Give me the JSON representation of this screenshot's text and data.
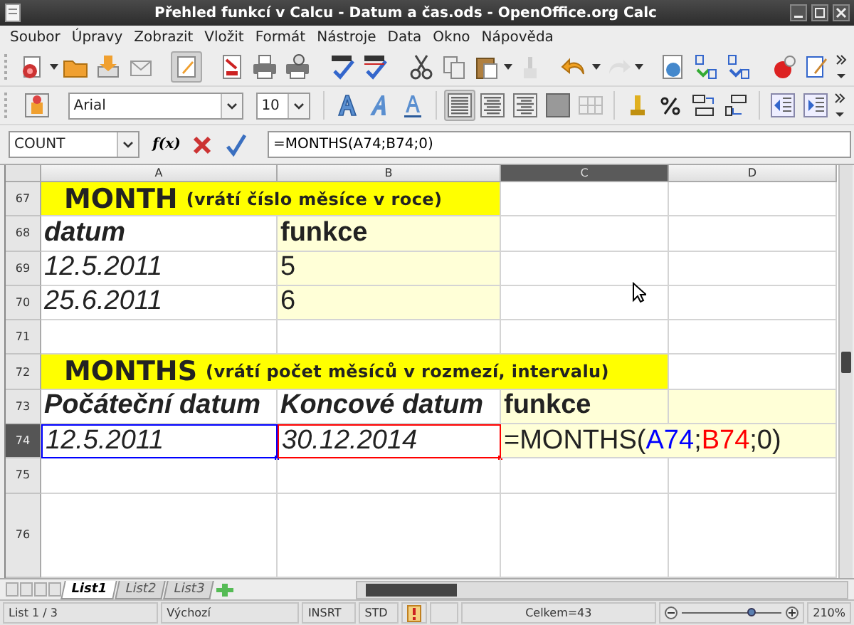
{
  "window": {
    "title": "Přehled funkcí v Calcu - Datum a čas.ods - OpenOffice.org Calc"
  },
  "menu": [
    "Soubor",
    "Úpravy",
    "Zobrazit",
    "Vložit",
    "Formát",
    "Nástroje",
    "Data",
    "Okno",
    "Nápověda"
  ],
  "formatting": {
    "font": "Arial",
    "size": "10"
  },
  "formula_bar": {
    "name_box": "COUNT",
    "function_label": "f(x)",
    "value": "=MONTHS(A74;B74;0)"
  },
  "columns": [
    {
      "label": "A",
      "selected": false
    },
    {
      "label": "B",
      "selected": false
    },
    {
      "label": "C",
      "selected": true
    },
    {
      "label": "D",
      "selected": false
    }
  ],
  "rows": [
    {
      "number": "67",
      "selected": false,
      "cells": [
        {
          "kind": "title",
          "title": "MONTH",
          "subtitle": "(vrátí číslo měsíce v roce)"
        },
        {
          "kind": "empty",
          "shaded": false
        },
        {
          "kind": "empty",
          "shaded": false
        }
      ]
    },
    {
      "number": "68",
      "selected": false,
      "cells": [
        {
          "kind": "heading",
          "text": "datum",
          "italic": true,
          "shaded": false
        },
        {
          "kind": "heading",
          "text": "funkce",
          "italic": false,
          "shaded": true
        },
        {
          "kind": "empty",
          "shaded": false
        },
        {
          "kind": "empty",
          "shaded": false
        }
      ]
    },
    {
      "number": "69",
      "selected": false,
      "cells": [
        {
          "kind": "value",
          "text": "12.5.2011",
          "italic": true,
          "shaded": false
        },
        {
          "kind": "value",
          "text": "5",
          "italic": false,
          "shaded": true
        },
        {
          "kind": "empty",
          "shaded": false
        },
        {
          "kind": "empty",
          "shaded": false
        }
      ]
    },
    {
      "number": "70",
      "selected": false,
      "cells": [
        {
          "kind": "value",
          "text": "25.6.2011",
          "italic": true,
          "shaded": false
        },
        {
          "kind": "value",
          "text": "6",
          "italic": false,
          "shaded": true
        },
        {
          "kind": "empty",
          "shaded": false
        },
        {
          "kind": "empty",
          "shaded": false
        }
      ]
    },
    {
      "number": "71",
      "selected": false,
      "cells": [
        {
          "kind": "empty",
          "shaded": false
        },
        {
          "kind": "empty",
          "shaded": false
        },
        {
          "kind": "empty",
          "shaded": false
        },
        {
          "kind": "empty",
          "shaded": false
        }
      ]
    },
    {
      "number": "72",
      "selected": false,
      "cells": [
        {
          "kind": "title",
          "title": "MONTHS",
          "subtitle": "(vrátí počet měsíců v rozmezí, intervalu)"
        },
        {
          "kind": "empty",
          "shaded": false
        }
      ]
    },
    {
      "number": "73",
      "selected": false,
      "cells": [
        {
          "kind": "heading",
          "text": "Počáteční datum",
          "italic": true,
          "shaded": false
        },
        {
          "kind": "heading",
          "text": "Koncové datum",
          "italic": true,
          "shaded": false
        },
        {
          "kind": "heading",
          "text": "funkce",
          "italic": false,
          "shaded": true
        },
        {
          "kind": "empty",
          "shaded": true
        }
      ]
    },
    {
      "number": "74",
      "selected": true,
      "cells": [
        {
          "kind": "value",
          "text": "12.5.2011",
          "italic": true,
          "shaded": false,
          "color": "#0000ff"
        },
        {
          "kind": "value",
          "text": "30.12.2014",
          "italic": true,
          "shaded": false,
          "color": "#ff0000"
        },
        {
          "kind": "formula",
          "shaded": true,
          "parts": [
            {
              "text": "=MONTHS("
            },
            {
              "text": "A74",
              "color": "#0000ff"
            },
            {
              "text": ";"
            },
            {
              "text": "B74",
              "color": "#ff0000"
            },
            {
              "text": ";0)"
            }
          ]
        }
      ]
    },
    {
      "number": "75",
      "selected": false,
      "cells": [
        {
          "kind": "empty",
          "shaded": false
        },
        {
          "kind": "empty",
          "shaded": false
        },
        {
          "kind": "empty",
          "shaded": false
        },
        {
          "kind": "empty",
          "shaded": false
        }
      ]
    },
    {
      "number": "76",
      "selected": false,
      "cells": [
        {
          "kind": "empty",
          "shaded": false
        },
        {
          "kind": "empty",
          "shaded": false
        },
        {
          "kind": "empty",
          "shaded": false
        },
        {
          "kind": "empty",
          "shaded": false
        }
      ]
    }
  ],
  "sheet_tabs": [
    {
      "label": "List1",
      "selected": true
    },
    {
      "label": "List2",
      "selected": false
    },
    {
      "label": "List3",
      "selected": false
    }
  ],
  "status_bar": {
    "sheet": "List 1 / 3",
    "page_style": "Výchozí",
    "insert_mode": "INSRT",
    "selection_mode": "STD",
    "sum": "Celkem=43",
    "zoom": {
      "level": 0.7
    },
    "zoom_text": "210%"
  }
}
